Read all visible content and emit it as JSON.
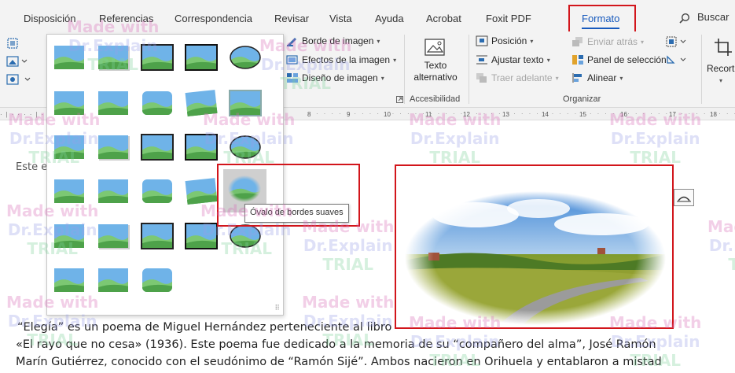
{
  "tabs": [
    "Disposición",
    "Referencias",
    "Correspondencia",
    "Revisar",
    "Vista",
    "Ayuda",
    "Acrobat",
    "Foxit PDF",
    "Formato"
  ],
  "search_label": "Buscar",
  "ribbon": {
    "picture_border": "Borde de imagen",
    "picture_effects": "Efectos de la imagen",
    "picture_layout": "Diseño de imagen",
    "alt_text": "Texto alternativo",
    "accessibility_group": "Accesibilidad",
    "position": "Posición",
    "wrap_text": "Ajustar texto",
    "bring_forward": "Traer adelante",
    "send_backward": "Enviar atrás",
    "selection_pane": "Panel de selección",
    "align": "Alinear",
    "arrange_group": "Organizar",
    "crop": "Recort"
  },
  "ruler_ticks": [
    "8",
    "9",
    "10",
    "11",
    "12",
    "13",
    "14",
    "15",
    "16",
    "17",
    "18"
  ],
  "gallery": {
    "tooltip": "Óvalo de bordes suaves",
    "hovered_style": "soft-edge-oval"
  },
  "document": {
    "partial_line": "Este e",
    "line1": "“Elegía” es un poema de Miguel Hernández perteneciente al libro",
    "line2": "«El rayo que no cesa» (1936). Este poema fue dedicado a la memoria de su “compañero del alma”, José Ramón",
    "line3": "Marín Gutiérrez, conocido con el seudónimo de “Ramón Sijé”. Ambos nacieron en Orihuela y entablaron a mistad"
  },
  "watermark": {
    "line1": "Made with",
    "line2": "Dr.Explain",
    "line3": "TRIAL"
  },
  "colors": {
    "accent": "#185abd",
    "highlight_red": "#d2151b"
  }
}
